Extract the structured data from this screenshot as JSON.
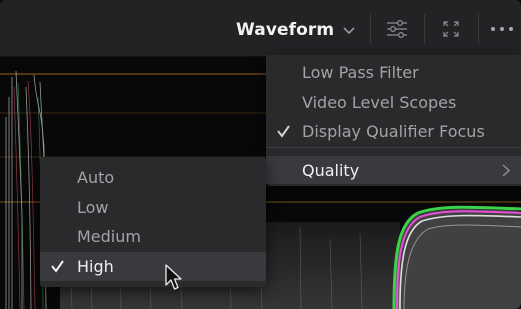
{
  "toolbar": {
    "scope_title": "Waveform",
    "buttons": [
      {
        "icon": "chevron-down-icon"
      },
      {
        "icon": "sliders-icon"
      },
      {
        "icon": "expand-icon"
      },
      {
        "icon": "more-icon"
      }
    ]
  },
  "options_menu": {
    "items": [
      {
        "label": "Low Pass Filter",
        "checked": false
      },
      {
        "label": "Video Level Scopes",
        "checked": false
      },
      {
        "label": "Display Qualifier Focus",
        "checked": true
      }
    ],
    "quality_label": "Quality"
  },
  "quality_submenu": {
    "items": [
      {
        "label": "Auto",
        "checked": false
      },
      {
        "label": "Low",
        "checked": false
      },
      {
        "label": "Medium",
        "checked": false
      },
      {
        "label": "High",
        "checked": true
      }
    ]
  },
  "colors": {
    "toolbar": "#232326",
    "menu": "#2a2a2d",
    "highlight": "#3a3a3e",
    "scope_line": "#c8891e"
  }
}
